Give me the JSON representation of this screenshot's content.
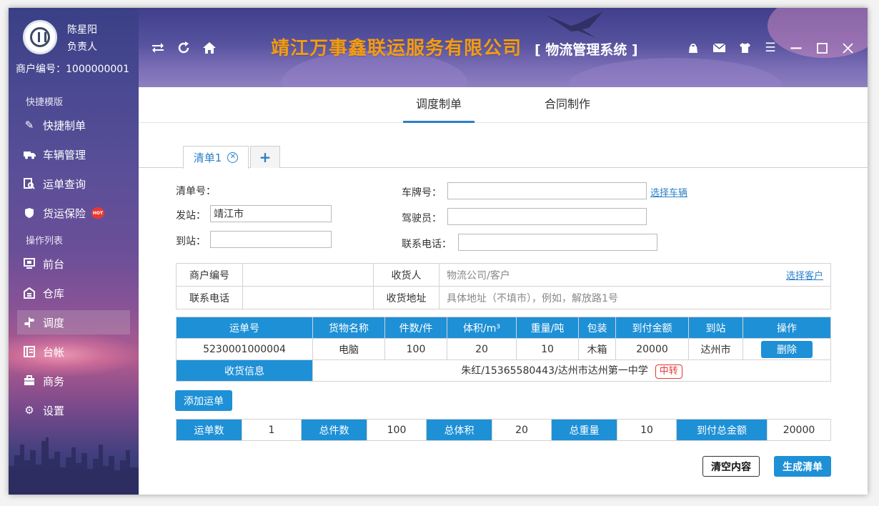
{
  "user": {
    "name": "陈星阳",
    "role": "负责人",
    "merchant_id": "商户编号：1000000001"
  },
  "sidebar": {
    "group1": "快捷模版",
    "group2": "操作列表",
    "items": [
      {
        "label": "快捷制单",
        "icon": "pencil-icon"
      },
      {
        "label": "车辆管理",
        "icon": "truck-icon"
      },
      {
        "label": "运单查询",
        "icon": "search-doc-icon"
      },
      {
        "label": "货运保险",
        "icon": "shield-icon",
        "badge": "HOT"
      },
      {
        "label": "前台",
        "icon": "monitor-icon"
      },
      {
        "label": "仓库",
        "icon": "warehouse-icon"
      },
      {
        "label": "调度",
        "icon": "dispatch-icon"
      },
      {
        "label": "台帐",
        "icon": "ledger-icon"
      },
      {
        "label": "商务",
        "icon": "briefcase-icon"
      },
      {
        "label": "设置",
        "icon": "gear-icon"
      }
    ]
  },
  "header": {
    "company": "靖江万事鑫联运服务有限公司",
    "system": "[ 物流管理系统 ]"
  },
  "tabs": {
    "dispatch": "调度制单",
    "contract": "合同制作"
  },
  "subtabs": {
    "list1": "清单1",
    "add": "+"
  },
  "form": {
    "list_no_label": "清单号：",
    "from_label": "发站：",
    "from_value": "靖江市",
    "to_label": "到站：",
    "to_value": "",
    "plate_label": "车牌号：",
    "plate_value": "",
    "select_vehicle": "选择车辆",
    "driver_label": "驾驶员：",
    "driver_value": "",
    "phone_label": "联系电话：",
    "phone_value": ""
  },
  "customer": {
    "merchant_label": "商户编号",
    "receiver_label": "收货人",
    "receiver_placeholder": "物流公司/客户",
    "select_customer": "选择客户",
    "phone_label": "联系电话",
    "address_label": "收货地址",
    "address_placeholder": "具体地址（不填市），例如，解放路1号"
  },
  "bill_table": {
    "headers": [
      "运单号",
      "货物名称",
      "件数/件",
      "体积/m³",
      "重量/吨",
      "包装",
      "到付金额",
      "到站",
      "操作"
    ],
    "rows": [
      {
        "waybill_no": "5230001000004",
        "goods": "电脑",
        "pieces": "100",
        "volume": "20",
        "weight": "10",
        "packing": "木箱",
        "cod": "20000",
        "station": "达州市",
        "action": "删除",
        "receipt_label": "收货信息",
        "receipt_info": "朱红/15365580443/达州市达州第一中学",
        "transfer_tag": "中转"
      }
    ]
  },
  "add_waybill": "添加运单",
  "summary": {
    "count_label": "运单数",
    "count": "1",
    "pieces_label": "总件数",
    "pieces": "100",
    "volume_label": "总体积",
    "volume": "20",
    "weight_label": "总重量",
    "weight": "10",
    "cod_label": "到付总金额",
    "cod": "20000"
  },
  "buttons": {
    "clear": "清空内容",
    "generate": "生成清单"
  },
  "colors": {
    "accent": "#1e90d6",
    "title": "#f39c12",
    "danger": "#e53935"
  }
}
